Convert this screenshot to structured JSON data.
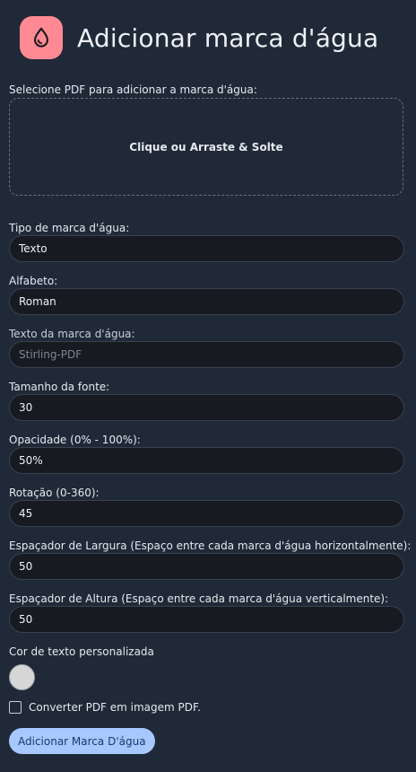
{
  "header": {
    "title": "Adicionar marca d'água",
    "logo_icon": "water-drop-icon",
    "logo_color": "#ff8a93"
  },
  "upload": {
    "label": "Selecione PDF para adicionar a marca d'água:",
    "dropzone_text": "Clique ou Arraste & Solte"
  },
  "fields": {
    "type": {
      "label": "Tipo de marca d'água:",
      "value": "Texto"
    },
    "alphabet": {
      "label": "Alfabeto:",
      "value": "Roman"
    },
    "text": {
      "label": "Texto da marca d'água:",
      "placeholder": "Stirling-PDF"
    },
    "font_size": {
      "label": "Tamanho da fonte:",
      "value": "30"
    },
    "opacity": {
      "label": "Opacidade (0% - 100%):",
      "value": "50%"
    },
    "rotation": {
      "label": "Rotação (0-360):",
      "value": "45"
    },
    "width_spacer": {
      "label": "Espaçador de Largura (Espaço entre cada marca d'água horizontalmente):",
      "value": "50"
    },
    "height_spacer": {
      "label": "Espaçador de Altura (Espaço entre cada marca d'água verticalmente):",
      "value": "50"
    }
  },
  "color": {
    "label": "Cor de texto personalizada",
    "value": "#d6d6d6"
  },
  "convert": {
    "label": "Converter PDF em imagem PDF.",
    "checked": false
  },
  "submit": {
    "label": "Adicionar Marca D'água",
    "color": "#a6c8ff"
  }
}
